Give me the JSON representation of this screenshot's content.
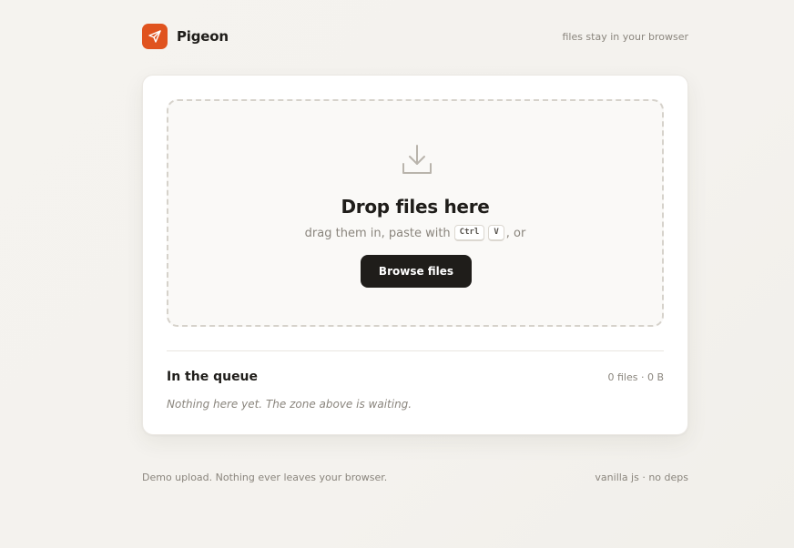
{
  "header": {
    "brand_name": "Pigeon",
    "logo_icon": "paper-plane-icon",
    "tagline": "files stay in your browser"
  },
  "dropzone": {
    "icon": "download-tray-icon",
    "title": "Drop files here",
    "subtitle_prefix": "drag them in, paste with",
    "key_1": "Ctrl",
    "key_2": "V",
    "subtitle_suffix": ", or",
    "browse_label": "Browse files"
  },
  "queue": {
    "title": "In the queue",
    "count": "0 files · 0 B",
    "empty_message": "Nothing here yet. The zone above is waiting."
  },
  "footer": {
    "left": "Demo upload. Nothing ever leaves your browser.",
    "right": "vanilla js · no deps"
  },
  "colors": {
    "accent": "#e0531f",
    "button": "#1f1d1a",
    "muted_text": "#8a857d"
  }
}
